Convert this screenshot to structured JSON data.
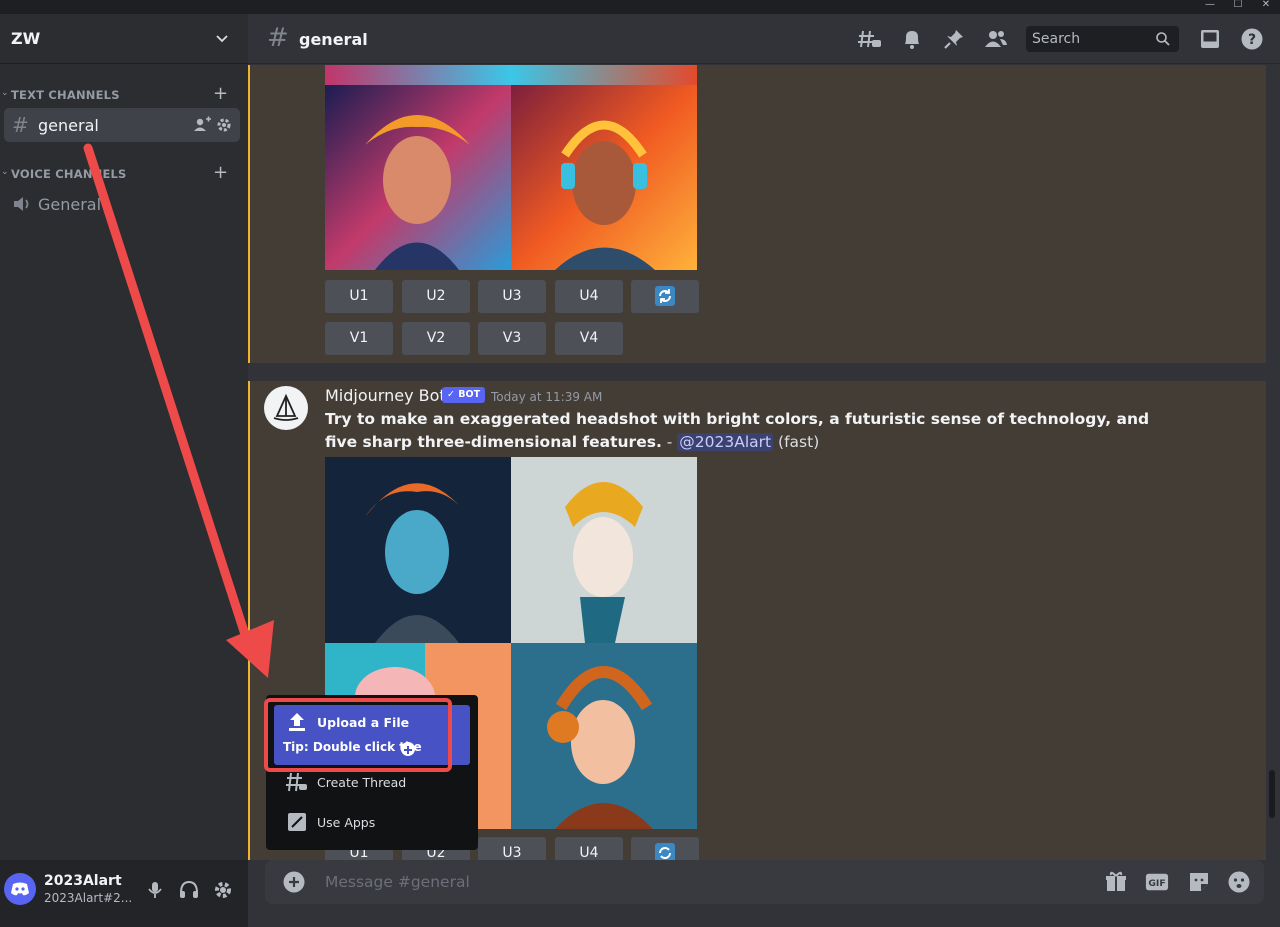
{
  "server": {
    "name": "ZW"
  },
  "sidebar": {
    "categories": [
      {
        "label": "TEXT CHANNELS"
      },
      {
        "label": "VOICE CHANNELS"
      }
    ],
    "channels": [
      {
        "label": "general",
        "type": "text",
        "active": true
      },
      {
        "label": "General",
        "type": "voice",
        "active": false
      }
    ]
  },
  "user": {
    "name": "2023Alart",
    "tag": "2023Alart#2..."
  },
  "header": {
    "channel": "general",
    "search_placeholder": "Search"
  },
  "message1": {
    "buttons_row1": [
      "U1",
      "U2",
      "U3",
      "U4"
    ],
    "buttons_row2": [
      "V1",
      "V2",
      "V3",
      "V4"
    ]
  },
  "message2": {
    "author": "Midjourney Bot",
    "badge": "✓ BOT",
    "time": "Today at 11:39 AM",
    "prompt": "Try to make an exaggerated headshot with bright colors, a futuristic sense of technology, and five sharp three-dimensional features.",
    "separator": " - ",
    "mention": "@2023Alart",
    "mode": "(fast)",
    "buttons_row1": [
      "U1",
      "U2",
      "U3",
      "U4"
    ]
  },
  "composer": {
    "placeholder": "Message #general"
  },
  "popup": {
    "items": [
      {
        "label": "Upload a File",
        "icon": "upload-icon"
      },
      {
        "label": "Create Thread",
        "icon": "thread-icon"
      },
      {
        "label": "Use Apps",
        "icon": "apps-icon"
      }
    ],
    "tip": "Tip: Double click the"
  },
  "colors": {
    "accent": "#5865f2",
    "highlight_bg": "#433d36",
    "highlight_bar": "#f0b232",
    "annotation": "#ef4a4a"
  }
}
